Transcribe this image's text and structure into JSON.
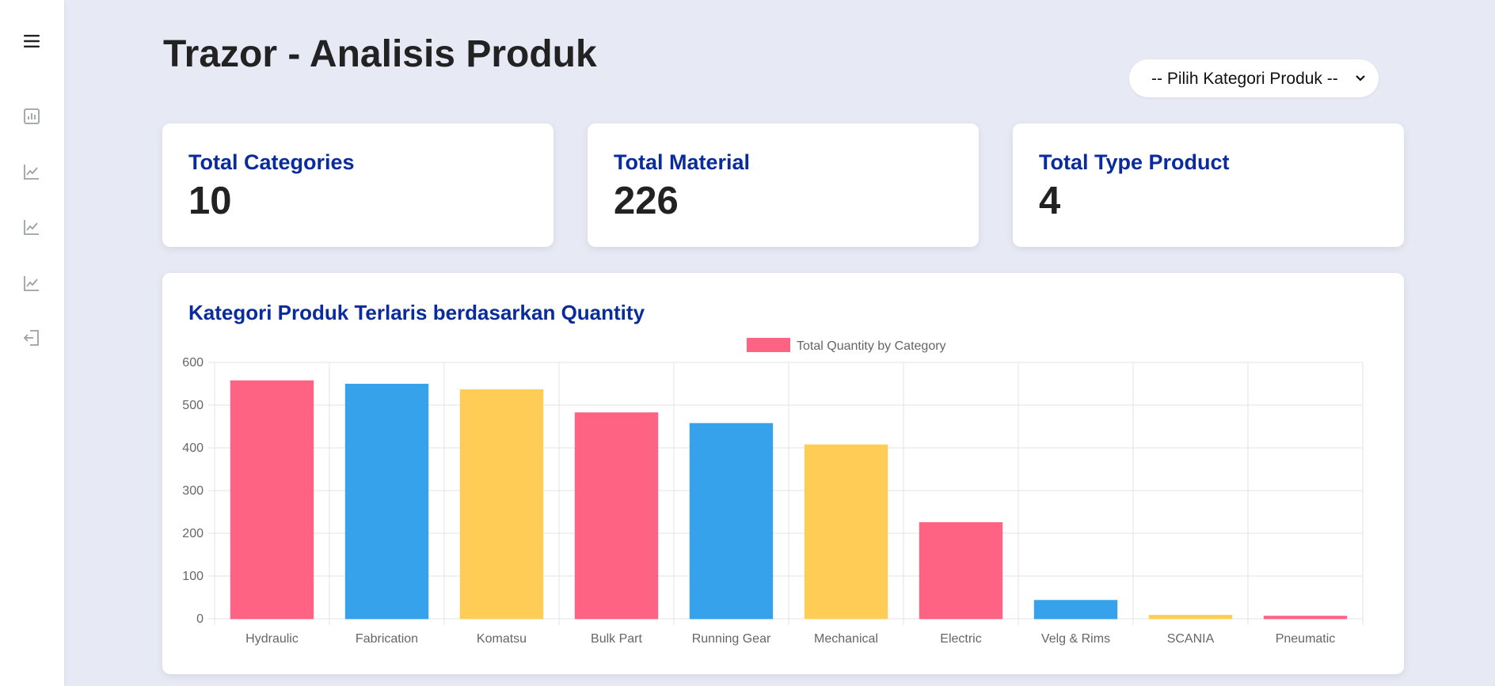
{
  "app": {
    "title": "Trazor - Analisis Produk"
  },
  "sidebar": {
    "items": [
      {
        "icon": "menu-icon",
        "label": "Menu"
      },
      {
        "icon": "bar-chart-icon",
        "label": "Bar chart"
      },
      {
        "icon": "line-chart-icon",
        "label": "Line chart"
      },
      {
        "icon": "line-chart-icon",
        "label": "Line chart"
      },
      {
        "icon": "line-chart-icon",
        "label": "Line chart"
      },
      {
        "icon": "logout-icon",
        "label": "Logout"
      }
    ]
  },
  "filter": {
    "selected": "-- Pilih Kategori Produk --"
  },
  "stats": [
    {
      "label": "Total Categories",
      "value": "10"
    },
    {
      "label": "Total Material",
      "value": "226"
    },
    {
      "label": "Total Type Product",
      "value": "4"
    }
  ],
  "colors": {
    "pink": "#ff6384",
    "blue": "#36a2eb",
    "yellow": "#ffcd56",
    "accent_text": "#0a2b9c"
  },
  "chart_data": {
    "type": "bar",
    "title": "Kategori Produk Terlaris berdasarkan Quantity",
    "categories": [
      "Hydraulic",
      "Fabrication",
      "Komatsu",
      "Bulk Part",
      "Running Gear",
      "Mechanical",
      "Electric",
      "Velg & Rims",
      "SCANIA",
      "Pneumatic"
    ],
    "series": [
      {
        "name": "Total Quantity by Category",
        "values": [
          557,
          549,
          536,
          482,
          457,
          407,
          225,
          43,
          8,
          6
        ]
      }
    ],
    "bar_colors": [
      "#ff6384",
      "#36a2eb",
      "#ffcd56",
      "#ff6384",
      "#36a2eb",
      "#ffcd56",
      "#ff6384",
      "#36a2eb",
      "#ffcd56",
      "#ff6384"
    ],
    "ylim": [
      0,
      600
    ],
    "yticks": [
      0,
      100,
      200,
      300,
      400,
      500,
      600
    ],
    "grid": true,
    "legend": "top-center"
  }
}
